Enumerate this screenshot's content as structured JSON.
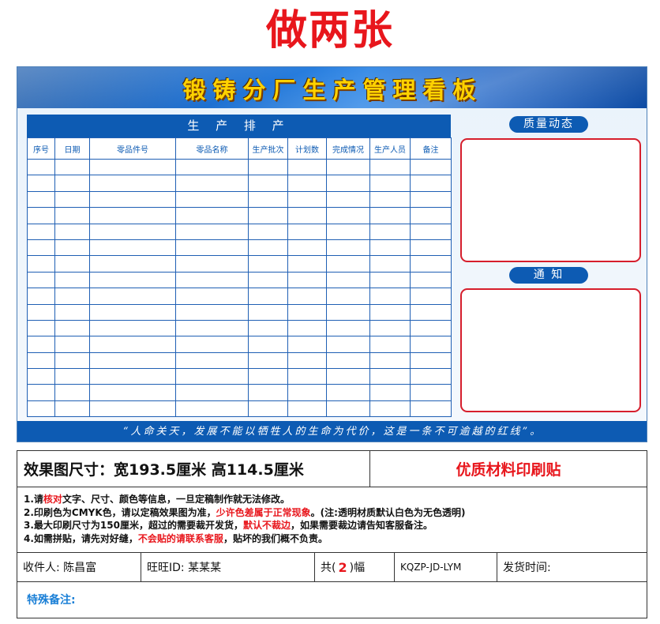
{
  "top_title": "做两张",
  "board": {
    "title": "锻铸分厂生产管理看板",
    "schedule": {
      "title": "生 产 排 产",
      "columns": [
        "序号",
        "日期",
        "零品件号",
        "零品名称",
        "生产批次",
        "计划数",
        "完成情况",
        "生产人员",
        "备注"
      ],
      "row_count": 16
    },
    "quality_title": "质量动态",
    "notice_title": "通  知",
    "motto": "“人命关天，发展不能以牺牲人的生命为代价，这是一条不可逾越的红线”。"
  },
  "order": {
    "size_label": "效果图尺寸：宽193.5厘米  高114.5厘米",
    "material_label": "优质材料印刷贴",
    "notes": [
      {
        "parts": [
          "1.请",
          "核对",
          "文字、尺寸、颜色等信息，一旦定稿制作就无法修改。"
        ]
      },
      {
        "parts": [
          "2.印刷色为CMYK色，请以定稿效果图为准，",
          "少许色差属于正常现象",
          "。(注:透明材质默认白色为无色透明)"
        ]
      },
      {
        "parts": [
          "3.最大印刷尺寸为150厘米，超过的需要裁开发货，",
          "默认不裁边",
          "，如果需要裁边请告知客服备注。"
        ]
      },
      {
        "parts": [
          "4.如需拼贴，请先对好缝，",
          "不会贴的请联系客服",
          "，贴坏的我们概不负责。"
        ]
      }
    ],
    "recipient": "收件人: 陈昌富",
    "wangwang": "旺旺ID:   某某某",
    "count_prefix": "共(",
    "count_value": "2",
    "count_suffix": ")幅",
    "code": "KQZP-JD-LYM",
    "ship_time": "发货时间:",
    "remark_label": "特殊备注:"
  }
}
